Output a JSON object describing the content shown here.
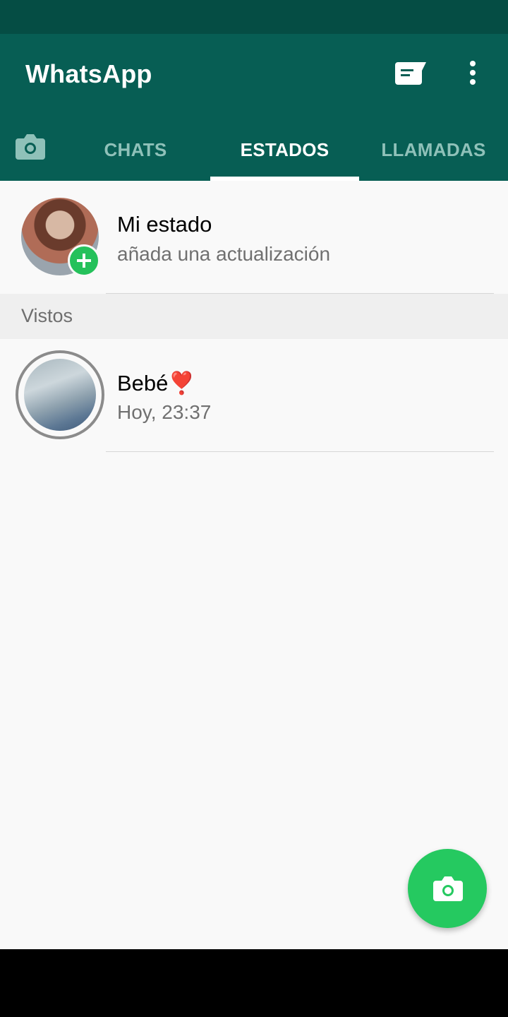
{
  "app": {
    "title": "WhatsApp"
  },
  "colors": {
    "header": "#075e54",
    "status_bar": "#054d44",
    "accent": "#25c15b",
    "inactive_tab": "#8fc1b9"
  },
  "icons": {
    "new_message": "message-icon",
    "overflow": "more-vert-icon",
    "camera_tab": "camera-icon",
    "fab": "camera-icon",
    "add": "plus-icon"
  },
  "tabs": [
    {
      "label": "CHATS",
      "active": false
    },
    {
      "label": "ESTADOS",
      "active": true
    },
    {
      "label": "LLAMADAS",
      "active": false
    }
  ],
  "my_status": {
    "title": "Mi estado",
    "subtitle": "añada una actualización"
  },
  "viewed": {
    "header": "Vistos",
    "items": [
      {
        "name": "Bebé❣️",
        "time": "Hoy, 23:37"
      }
    ]
  }
}
